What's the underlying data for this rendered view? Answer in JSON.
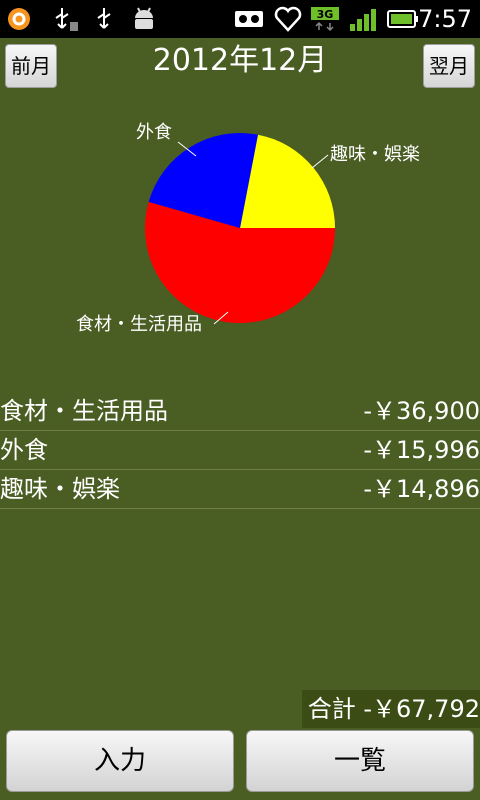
{
  "status_bar": {
    "time": "7:57",
    "network": "3G",
    "icons": [
      "notification-ring-icon",
      "usb-icon",
      "usb-icon",
      "android-icon",
      "voicemail-icon",
      "heart-icon",
      "3g-icon",
      "signal-icon",
      "battery-icon"
    ]
  },
  "header": {
    "prev_label": "前月",
    "title": "2012年12月",
    "next_label": "翌月"
  },
  "chart_data": {
    "type": "pie",
    "slices": [
      {
        "label": "趣味・娯楽",
        "value": 14896,
        "color": "#ffff00"
      },
      {
        "label": "外食",
        "value": 15996,
        "color": "#0000ff"
      },
      {
        "label": "食材・生活用品",
        "value": 36900,
        "color": "#ff0000"
      }
    ]
  },
  "list": {
    "rows": [
      {
        "category": "食材・生活用品",
        "amount": "-￥36,900"
      },
      {
        "category": "外食",
        "amount": "-￥15,996"
      },
      {
        "category": "趣味・娯楽",
        "amount": "-￥14,896"
      }
    ]
  },
  "total": {
    "label": "合計",
    "amount": "-￥67,792"
  },
  "buttons": {
    "input_label": "入力",
    "list_label": "一覧"
  },
  "colors": {
    "background": "#4a5d23",
    "total_background": "#3b4d14"
  }
}
